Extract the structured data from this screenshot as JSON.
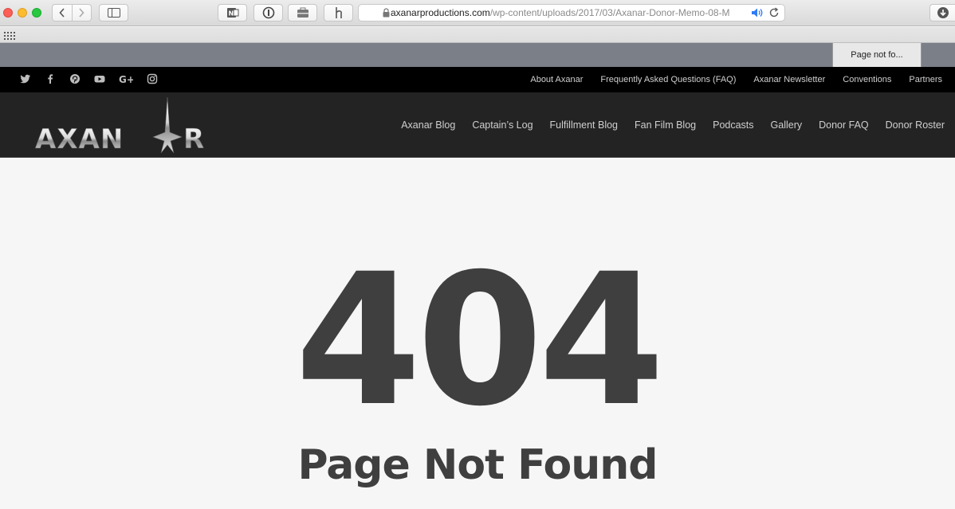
{
  "browser": {
    "url_host": "axanarproductions.com",
    "url_path": "/wp-content/uploads/2017/03/Axanar-Donor-Memo-08-M",
    "tab_title": "Page not fo..."
  },
  "site": {
    "social_icons": [
      "twitter-icon",
      "facebook-icon",
      "pinterest-icon",
      "youtube-icon",
      "google-plus-icon",
      "instagram-icon"
    ],
    "top_links": [
      "About Axanar",
      "Frequently Asked Questions (FAQ)",
      "Axanar Newsletter",
      "Conventions",
      "Partners"
    ],
    "logo_text": "AXANAR",
    "nav_links": [
      "Axanar Blog",
      "Captain’s Log",
      "Fulfillment Blog",
      "Fan Film Blog",
      "Podcasts",
      "Gallery",
      "Donor FAQ",
      "Donor Roster"
    ]
  },
  "error": {
    "code": "404",
    "message": "Page Not Found"
  },
  "colors": {
    "topbar": "#000000",
    "navbar": "#232323",
    "content_bg": "#f6f6f6",
    "error_text": "#3f3f3f",
    "tabbar": "#7b7f88"
  }
}
